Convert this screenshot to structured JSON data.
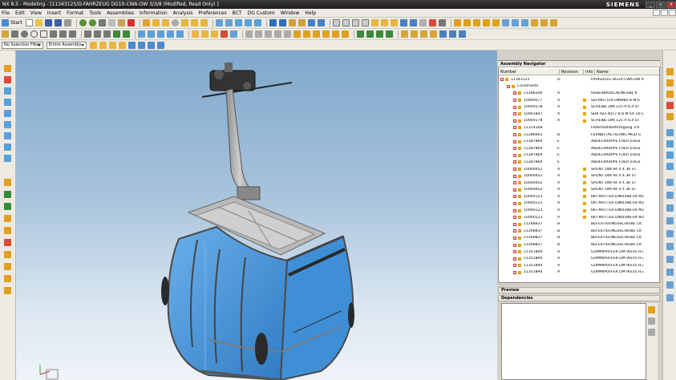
{
  "window": {
    "title": "NX 8.5 - Modeling - [11343125/D-FAHRZEUG DG10-CWA-OW 3/3/8 (Modified, Read Only) ]",
    "brand": "SIEMENS",
    "controls": [
      "_",
      "▫",
      "x"
    ]
  },
  "menu": [
    "File",
    "Edit",
    "View",
    "Insert",
    "Format",
    "Tools",
    "Assemblies",
    "Information",
    "Analysis",
    "Preferences",
    "BCT",
    "DG Custom",
    "Window",
    "Help"
  ],
  "toolbar": {
    "start_label": "Start"
  },
  "selection": {
    "filter_value": "No Selection Filter",
    "scope_value": "Entire Assembly"
  },
  "navigator": {
    "title": "Assembly Navigator",
    "columns": [
      "Number",
      "Revision",
      "Info",
      "Name"
    ],
    "rows": [
      {
        "number": "11343125",
        "revision": "D",
        "info": false,
        "name": "FAHRZEUG DG10-CWA-OW K"
      },
      {
        "number": "Constraints",
        "revision": "",
        "info": false,
        "name": ""
      },
      {
        "number": "11288340",
        "revision": "A",
        "info": false,
        "name": "UEBERBRUECKUNGSBL K"
      },
      {
        "number": "10000077",
        "revision": "A",
        "info": true,
        "name": "SSI-MUTTER DIN985-8 M 6"
      },
      {
        "number": "10000178",
        "revision": "A",
        "info": true,
        "name": "SCHEIBE DIN 125 A 6,4 ST"
      },
      {
        "number": "10001847",
        "revision": "A",
        "info": true,
        "name": "SHR ISO 4017-8.8 M 6X 16-C"
      },
      {
        "number": "10000178",
        "revision": "A",
        "info": true,
        "name": "SCHEIBE DIN 125 A 6,4 ST"
      },
      {
        "number": "11314168",
        "revision": "",
        "info": false,
        "name": "Federstahlbefestigung 3-6"
      },
      {
        "number": "11286663",
        "revision": "B",
        "info": false,
        "name": "FERNBETAETIGUNG MGD G"
      },
      {
        "number": "11287869",
        "revision": "E",
        "info": false,
        "name": "ABDECKKAPPE FUER ZUGS"
      },
      {
        "number": "11287869",
        "revision": "E",
        "info": false,
        "name": "ABDECKKAPPE FUER ZUGS"
      },
      {
        "number": "11287869",
        "revision": "E",
        "info": false,
        "name": "ABDECKKAPPE FUER ZUGS"
      },
      {
        "number": "11287869",
        "revision": "E",
        "info": false,
        "name": "ABDECKKAPPE FUER ZUGS"
      },
      {
        "number": "10000452",
        "revision": "A",
        "info": true,
        "name": "SPLINT DIN 94 4 X 36 ST"
      },
      {
        "number": "10000452",
        "revision": "A",
        "info": true,
        "name": "SPLINT DIN 94 4 X 36 ST"
      },
      {
        "number": "10000452",
        "revision": "A",
        "info": true,
        "name": "SPLINT DIN 94 4 X 36 ST"
      },
      {
        "number": "10000452",
        "revision": "A",
        "info": true,
        "name": "SPLINT DIN 94 4 X 36 ST"
      },
      {
        "number": "10000123",
        "revision": "A",
        "info": true,
        "name": "6KT-MUTTER DIN439B-04 M2"
      },
      {
        "number": "10000123",
        "revision": "A",
        "info": true,
        "name": "6KT-MUTTER DIN439B-04 M2"
      },
      {
        "number": "10000123",
        "revision": "A",
        "info": true,
        "name": "6KT-MUTTER DIN439B-04 M2"
      },
      {
        "number": "10000123",
        "revision": "A",
        "info": true,
        "name": "6KT-MUTTER DIN439B-04 M2"
      },
      {
        "number": "11268837",
        "revision": "B",
        "info": false,
        "name": "BEFESTIGUNGSSCHEIBE CK"
      },
      {
        "number": "11268837",
        "revision": "B",
        "info": false,
        "name": "BEFESTIGUNGSSCHEIBE CK"
      },
      {
        "number": "11268837",
        "revision": "B",
        "info": false,
        "name": "BEFESTIGUNGSSCHEIBE CK"
      },
      {
        "number": "11268837",
        "revision": "B",
        "info": false,
        "name": "BEFESTIGUNGSSCHEIBE CK"
      },
      {
        "number": "11351894",
        "revision": "A",
        "info": false,
        "name": "GUMMIPUFFER DM 90/35 H="
      },
      {
        "number": "11351894",
        "revision": "A",
        "info": false,
        "name": "GUMMIPUFFER DM 90/35 H="
      },
      {
        "number": "11351894",
        "revision": "A",
        "info": false,
        "name": "GUMMIPUFFER DM 90/35 H="
      },
      {
        "number": "11351894",
        "revision": "A",
        "info": false,
        "name": "GUMMIPUFFER DM 90/35 H="
      }
    ]
  },
  "preview": {
    "title": "Preview"
  },
  "dependencies": {
    "title": "Dependencies"
  },
  "colors": {
    "cabin_glass": "#3f8fd6",
    "frame": "#a9a9a9",
    "viewport_top": "#7fa8cc",
    "info_icon": "#e3a400"
  }
}
